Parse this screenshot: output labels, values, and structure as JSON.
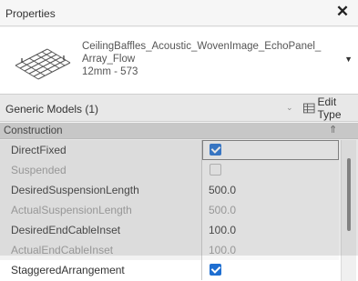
{
  "window": {
    "title": "Properties",
    "close_glyph": "✕"
  },
  "type_selector": {
    "name_line1": "CeilingBaffles_Acoustic_WovenImage_EchoPanel_",
    "name_line2": "Array_Flow",
    "name_line3": "12mm - 573",
    "dropdown_glyph": "▼",
    "thumbnail_icon": "baffle-array-thumbnail-icon"
  },
  "instance": {
    "label": "Generic Models (1)",
    "dropdown_glyph": "⌄",
    "edit_type_label": "Edit Type",
    "edit_type_icon": "edit-type-icon"
  },
  "group": {
    "label": "Construction",
    "toggle_glyph": "⇑"
  },
  "properties": [
    {
      "name": "DirectFixed",
      "kind": "checkbox",
      "checked": true,
      "enabled": true
    },
    {
      "name": "Suspended",
      "kind": "checkbox",
      "checked": false,
      "enabled": false
    },
    {
      "name": "DesiredSuspensionLength",
      "kind": "text",
      "value": "500.0",
      "enabled": true
    },
    {
      "name": "ActualSuspensionLength",
      "kind": "text",
      "value": "500.0",
      "enabled": false
    },
    {
      "name": "DesiredEndCableInset",
      "kind": "text",
      "value": "100.0",
      "enabled": true
    },
    {
      "name": "ActualEndCableInset",
      "kind": "text",
      "value": "100.0",
      "enabled": false
    },
    {
      "name": "StaggeredArrangement",
      "kind": "checkbox",
      "checked": true,
      "enabled": true
    }
  ],
  "colors": {
    "checkbox_checked": "#1f6fd1",
    "disabled_text": "#9a9a9a"
  }
}
